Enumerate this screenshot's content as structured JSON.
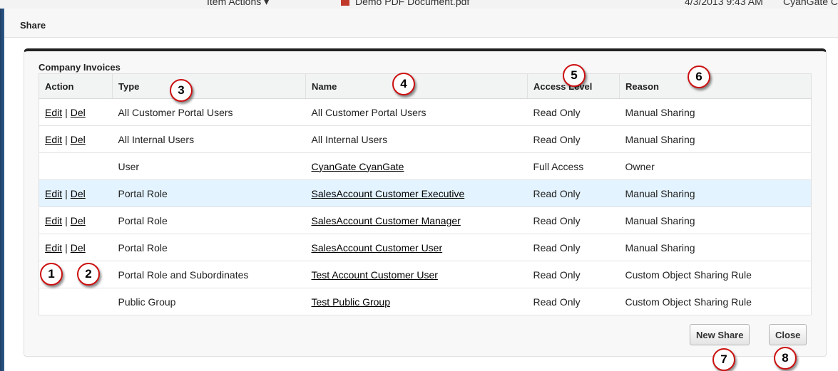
{
  "background": {
    "item_actions": "Item Actions ▾",
    "doc_name": "Demo PDF Document.pdf",
    "date": "4/3/2013 9:43 AM",
    "owner": "CyanGate C"
  },
  "dialog": {
    "title": "Share"
  },
  "panel": {
    "section_title": "Company Invoices"
  },
  "table": {
    "headers": {
      "action": "Action",
      "type": "Type",
      "name": "Name",
      "access": "Access Level",
      "reason": "Reason"
    },
    "edit_label": "Edit",
    "del_label": "Del",
    "separator": "|",
    "rows": [
      {
        "type": "All Customer Portal Users",
        "name": "All Customer Portal Users",
        "access": "Read Only",
        "reason": "Manual Sharing"
      },
      {
        "type": "All Internal Users",
        "name": "All Internal Users",
        "access": "Read Only",
        "reason": "Manual Sharing"
      },
      {
        "type": "User",
        "name": "CyanGate CyanGate",
        "access": "Full Access",
        "reason": "Owner"
      },
      {
        "type": "Portal Role",
        "name": "SalesAccount Customer Executive",
        "access": "Read Only",
        "reason": "Manual Sharing"
      },
      {
        "type": "Portal Role",
        "name": "SalesAccount Customer Manager",
        "access": "Read Only",
        "reason": "Manual Sharing"
      },
      {
        "type": "Portal Role",
        "name": "SalesAccount Customer User",
        "access": "Read Only",
        "reason": "Manual Sharing"
      },
      {
        "type": "Portal Role and Subordinates",
        "name": "Test Account Customer User",
        "access": "Read Only",
        "reason": "Custom Object Sharing Rule"
      },
      {
        "type": "Public Group",
        "name": "Test Public Group",
        "access": "Read Only",
        "reason": "Custom Object Sharing Rule"
      }
    ]
  },
  "buttons": {
    "new_share": "New Share",
    "close": "Close"
  },
  "callouts": [
    "1",
    "2",
    "3",
    "4",
    "5",
    "6",
    "7",
    "8"
  ],
  "colors": {
    "highlight_row": "#e3f3ff",
    "callout_border": "#cc1111",
    "panel_top_border": "#222222"
  }
}
